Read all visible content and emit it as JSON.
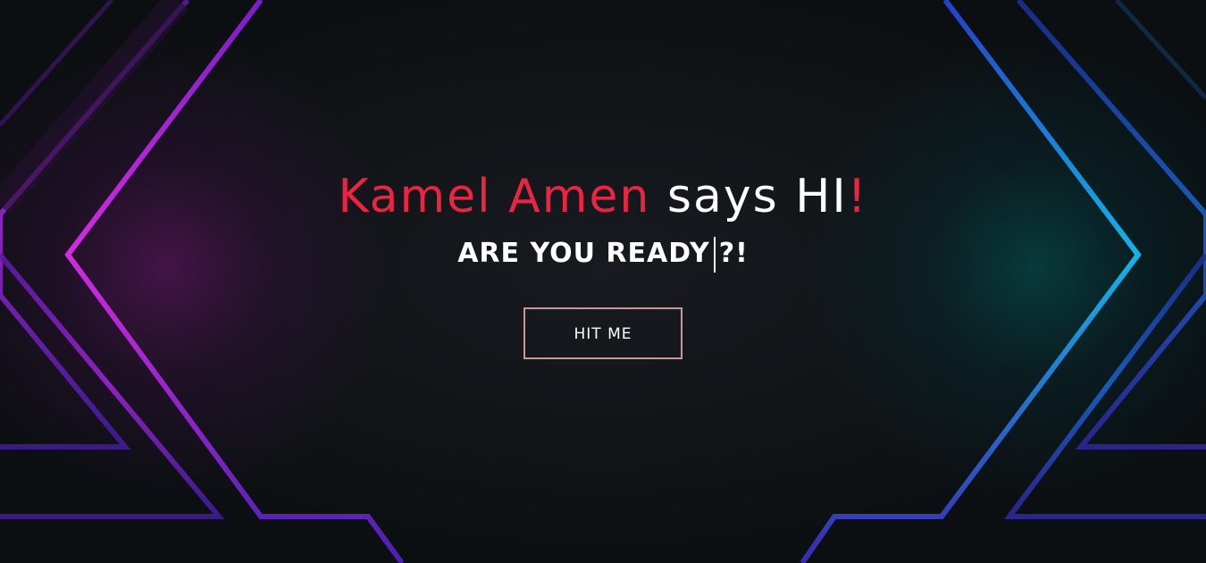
{
  "hero": {
    "name_text": "Kamel Amen",
    "says_text": "says HI",
    "exclaim": "!",
    "tagline": "ARE YOU READY",
    "tagline_suffix": "?!"
  },
  "cta": {
    "label": "HIT ME"
  },
  "colors": {
    "accent_red": "#ea2543",
    "neon_purple": "#c52bdb",
    "neon_cyan": "#1fb6e0",
    "button_border": "#c9979a",
    "background": "#0e1114"
  }
}
